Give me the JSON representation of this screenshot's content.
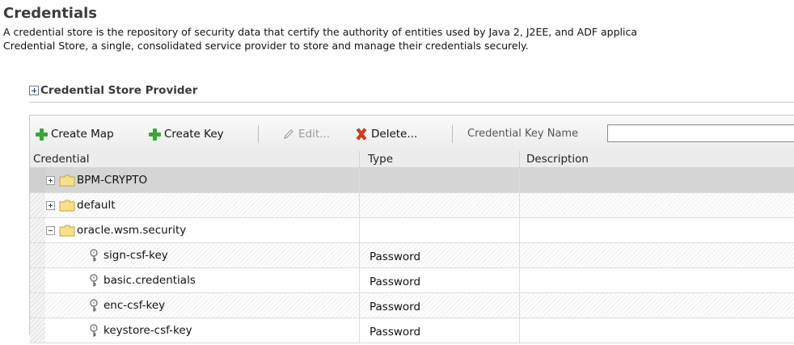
{
  "page": {
    "title": "Credentials",
    "description_line1": "A credential store is the repository of security data that certify the authority of entities used by Java 2, J2EE, and ADF applica",
    "description_line2": "Credential Store, a single, consolidated service provider to store and manage their credentials securely."
  },
  "section": {
    "header": "Credential Store Provider",
    "toggle_icon": "expand-plus-icon"
  },
  "toolbar": {
    "create_map": "Create Map",
    "create_key": "Create Key",
    "edit": "Edit...",
    "delete": "Delete...",
    "key_name_label": "Credential Key Name",
    "key_name_value": "",
    "icons": [
      "plus-icon",
      "plus-icon",
      "pencil-icon",
      "red-x-icon"
    ]
  },
  "table": {
    "columns": [
      "Credential",
      "Type",
      "Description"
    ],
    "rows": [
      {
        "kind": "map",
        "expanded": false,
        "name": "BPM-CRYPTO",
        "type": "",
        "description": "",
        "selected": true
      },
      {
        "kind": "map",
        "expanded": false,
        "name": "default",
        "type": "",
        "description": "",
        "selected": false
      },
      {
        "kind": "map",
        "expanded": true,
        "name": "oracle.wsm.security",
        "type": "",
        "description": "",
        "selected": false
      },
      {
        "kind": "key",
        "name": "sign-csf-key",
        "type": "Password",
        "description": "",
        "selected": false
      },
      {
        "kind": "key",
        "name": "basic.credentials",
        "type": "Password",
        "description": "",
        "selected": false
      },
      {
        "kind": "key",
        "name": "enc-csf-key",
        "type": "Password",
        "description": "",
        "selected": false
      },
      {
        "kind": "key",
        "name": "keystore-csf-key",
        "type": "Password",
        "description": "",
        "selected": false
      }
    ]
  },
  "colors": {
    "plus_green": "#3aa63a",
    "delete_red": "#d93a1a",
    "folder_yellow": "#f7e08a",
    "selected_row": "#d5d5d5"
  }
}
